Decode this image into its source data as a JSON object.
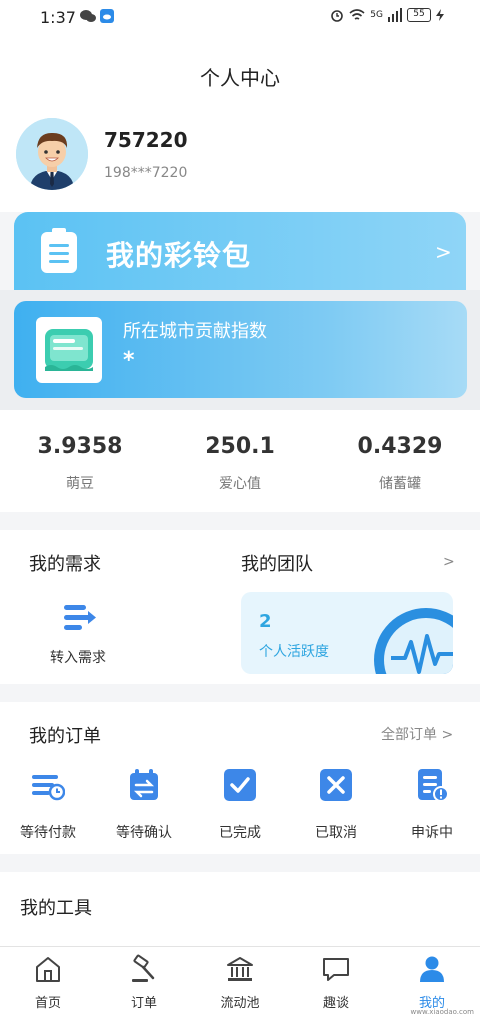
{
  "status_bar": {
    "time": "1:37",
    "battery": "55",
    "network": "5G"
  },
  "header": {
    "title": "个人中心"
  },
  "profile": {
    "name": "757220",
    "phone": "198***7220"
  },
  "ring_banner": {
    "label": "我的彩铃包",
    "arrow": ">"
  },
  "city_index": {
    "title": "所在城市贡献指数",
    "value": "*"
  },
  "stats": [
    {
      "value": "3.9358",
      "label": "萌豆"
    },
    {
      "value": "250.1",
      "label": "爱心值"
    },
    {
      "value": "0.4329",
      "label": "储蓄罐"
    }
  ],
  "demand": {
    "title": "我的需求",
    "item_label": "转入需求"
  },
  "team": {
    "title": "我的团队",
    "arrow": ">",
    "count": "2",
    "count_label": "个人活跃度"
  },
  "orders": {
    "title": "我的订单",
    "all_label": "全部订单 >",
    "items": [
      {
        "label": "等待付款",
        "icon": "wallet-clock-icon"
      },
      {
        "label": "等待确认",
        "icon": "calendar-swap-icon"
      },
      {
        "label": "已完成",
        "icon": "check-icon"
      },
      {
        "label": "已取消",
        "icon": "cancel-icon"
      },
      {
        "label": "申诉中",
        "icon": "document-alert-icon"
      }
    ]
  },
  "tools": {
    "title": "我的工具"
  },
  "tabbar": {
    "items": [
      {
        "label": "首页",
        "icon": "home-icon"
      },
      {
        "label": "订单",
        "icon": "gavel-icon"
      },
      {
        "label": "流动池",
        "icon": "bank-icon"
      },
      {
        "label": "趣谈",
        "icon": "chat-icon"
      },
      {
        "label": "我的",
        "icon": "person-icon"
      }
    ],
    "active": 4
  },
  "watermark": "www.xiaodao.com",
  "colors": {
    "accent": "#2c8be8",
    "banner": "#5bc2f3",
    "icon_blue": "#3d87e8"
  }
}
